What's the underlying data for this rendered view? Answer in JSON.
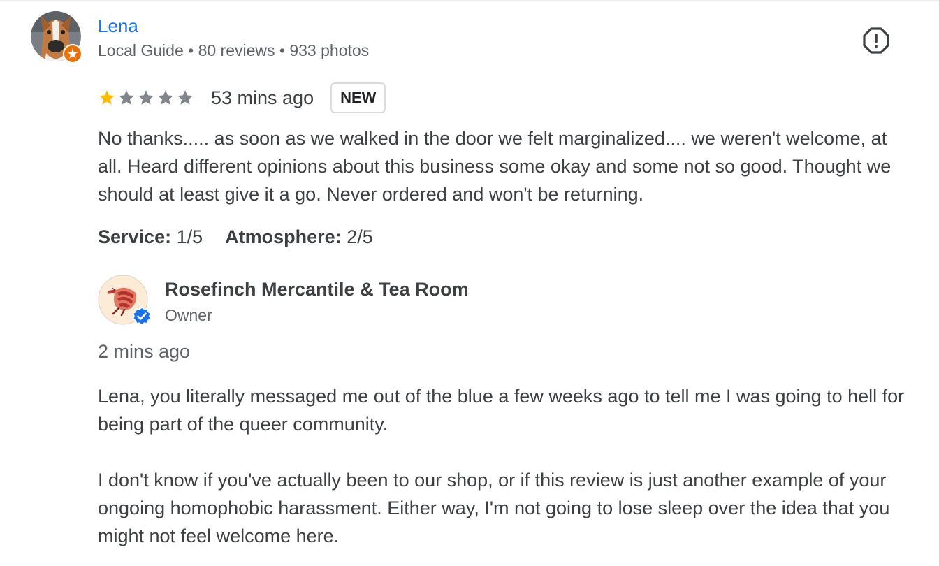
{
  "review": {
    "reviewer": {
      "name": "Lena",
      "meta": "Local Guide • 80 reviews • 933 photos",
      "avatar_icon": "boxer-dog-photo",
      "badge_icon": "local-guide-star-badge",
      "badge_color": "#e8710a"
    },
    "report_icon": "report-flag-icon",
    "rating": {
      "value": 1,
      "max": 5,
      "filled_color": "#fbbc04",
      "empty_color": "#80868b"
    },
    "time": "53 mins ago",
    "badge": "NEW",
    "text": "No thanks..... as soon as we walked in the door we felt marginalized.... we weren't welcome, at all. Heard different opinions about this business some okay and some not so good. Thought we should at least give it a go. Never ordered and won't be returning.",
    "attributes": [
      {
        "label": "Service:",
        "value": "1/5"
      },
      {
        "label": "Atmosphere:",
        "value": "2/5"
      }
    ]
  },
  "owner_response": {
    "name": "Rosefinch Mercantile & Tea Room",
    "role": "Owner",
    "logo_icon": "rosefinch-bird-logo",
    "verified_icon": "verified-check-badge",
    "verified_color": "#1a73e8",
    "time": "2 mins ago",
    "paragraphs": [
      "Lena, you literally messaged me out of the blue a few weeks ago to tell me I was going to hell for being part of the queer community.",
      "I don't know if you've actually been to our shop, or if this review is just another example of your ongoing homophobic harassment. Either way, I'm not going to lose sleep over the idea that you might not feel welcome here."
    ]
  }
}
